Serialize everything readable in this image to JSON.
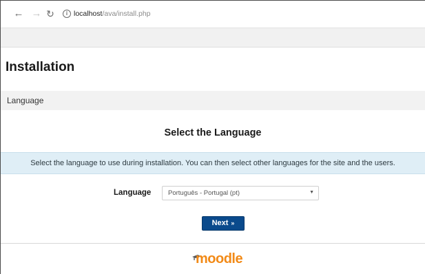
{
  "browser": {
    "url_host": "localhost",
    "url_path": "/ava/install.php",
    "icons": [
      "back-arrow-icon",
      "forward-arrow-icon",
      "reload-icon",
      "info-icon"
    ]
  },
  "page": {
    "title": "Installation",
    "stage": "Language",
    "heading": "Select the Language",
    "info": "Select the language to use during installation. You can then select other languages for the site and the users.",
    "language_label": "Language",
    "language_selected": "Português - Portugal (pt)",
    "next_label": "Next",
    "next_arrow": "»"
  },
  "footer": {
    "logo_text": "moodle"
  },
  "colors": {
    "info_bg": "#dfeef6",
    "button_bg": "#0a4a8c",
    "logo_orange": "#f28a17",
    "stage_bg": "#f2f2f2"
  }
}
